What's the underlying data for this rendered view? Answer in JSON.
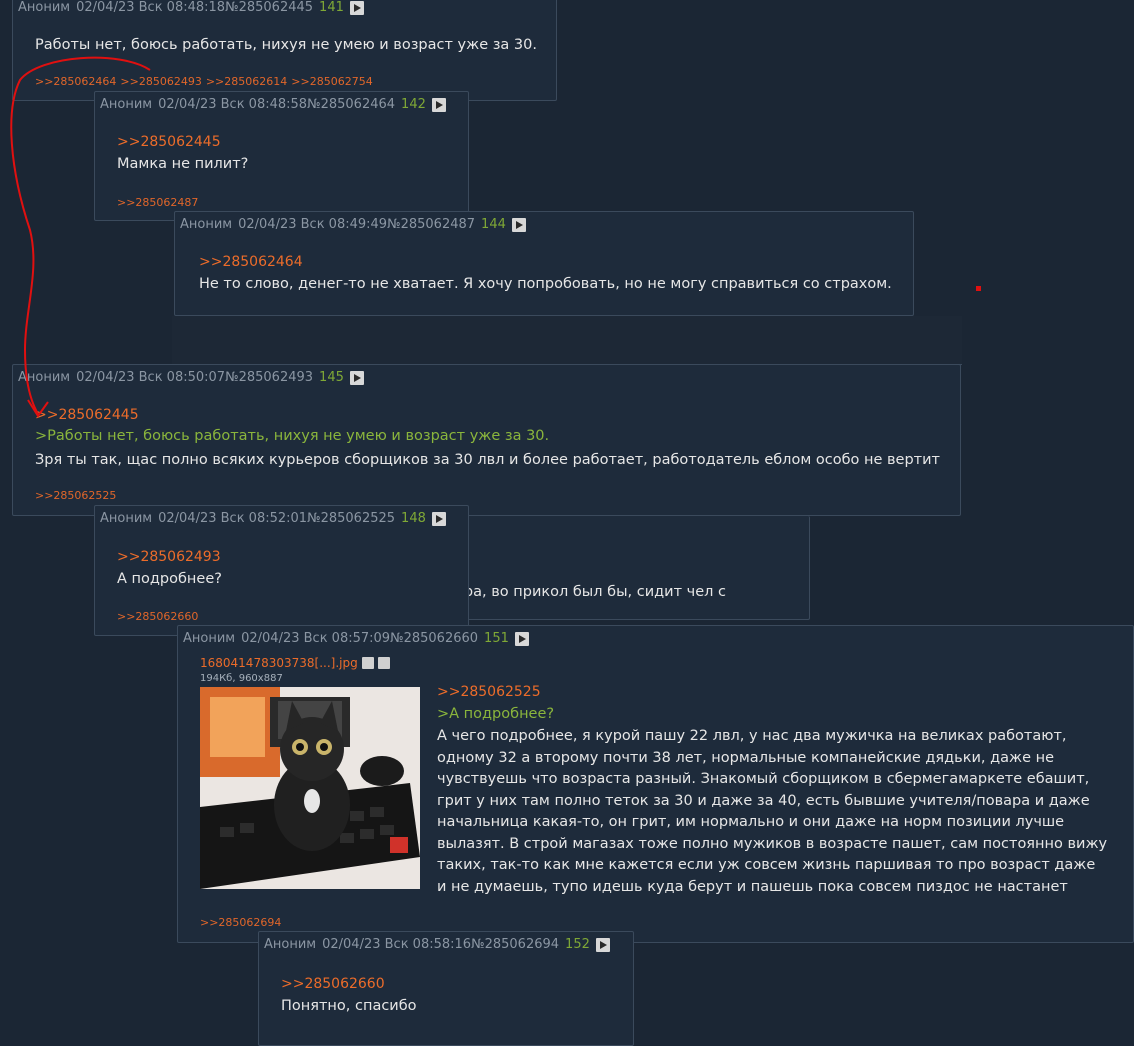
{
  "posts": [
    {
      "author": "Аноним",
      "date": "02/04/23 Вск 08:48:18",
      "id": "№285062445",
      "num": "141",
      "text": "Работы нет, боюсь работать, нихуя не умею и возраст уже за 30.",
      "backlinks": [
        ">>285062464",
        ">>285062493",
        ">>285062614",
        ">>285062754"
      ]
    },
    {
      "author": "Аноним",
      "date": "02/04/23 Вск 08:48:58",
      "id": "№285062464",
      "num": "142",
      "reply_to": ">>285062445",
      "text": "Мамка не пилит?",
      "backlinks": [
        ">>285062487"
      ]
    },
    {
      "author": "Аноним",
      "date": "02/04/23 Вск 08:49:49",
      "id": "№285062487",
      "num": "144",
      "reply_to": ">>285062464",
      "text": "Не то слово, денег-то не хватает. Я хочу попробовать, но не могу справиться со страхом."
    },
    {
      "author": "Аноним",
      "date": "02/04/23 Вск 08:50:07",
      "id": "№285062493",
      "num": "145",
      "reply_to": ">>285062445",
      "quote": ">Работы нет, боюсь работать, нихуя не умею и возраст уже за 30.",
      "text": "Зря ты так, щас полно всяких курьеров сборщиков за 30 лвл и более работает, работодатель еблом особо не вертит",
      "backlinks": [
        ">>285062525"
      ]
    },
    {
      "author": "Аноним",
      "date": "02/04/23 Вск 08:52:01",
      "id": "№285062525",
      "num": "148",
      "reply_to": ">>285062493",
      "text": "А подробнее?",
      "backlinks": [
        ">>285062660"
      ]
    },
    {
      "author": "Аноним",
      "date": "02/04/23 Вск 08:57:09",
      "id": "№285062660",
      "num": "151",
      "file_name": "168041478303738[...].jpg",
      "file_meta": "194Кб, 960x887",
      "reply_to": ">>285062525",
      "quote": ">А подробнее?",
      "text": "А чего подробнее, я курой пашу 22 лвл, у нас два мужичка на великах работают, одному 32 а второму почти 38 лет, нормальные компанейские дядьки, даже не чувствуешь что возраста разный. Знакомый сборщиком в сбермегамаркете ебашит, грит у них там полно теток за 30 и даже за 40, есть бывшие учителя/повара и даже начальница какая-то, он грит, им нормально и они даже на норм позиции лучше вылазят. В строй магазах тоже полно мужиков в возрасте пашет, сам постоянно вижу таких, так-то как мне кажется если уж совсем жизнь паршивая то про возраст даже и не думаешь, тупо идешь куда берут и пашешь пока совсем пиздос не настанет",
      "backlinks": [
        ">>285062694"
      ]
    },
    {
      "author": "Аноним",
      "date": "02/04/23 Вск 08:58:16",
      "id": "№285062694",
      "num": "152",
      "reply_to": ">>285062660",
      "text": "Понятно, спасибо"
    }
  ],
  "ghost": {
    "hidden_fragment": "ера, во прикол был бы, сидит чел с"
  },
  "colors": {
    "background": "#1b2634",
    "post_bg": "#1e2b3b",
    "reply_link": "#ec6c2a",
    "greentext": "#8ab53c",
    "post_number": "#7fa836",
    "annotation_arrow": "#e01010"
  }
}
